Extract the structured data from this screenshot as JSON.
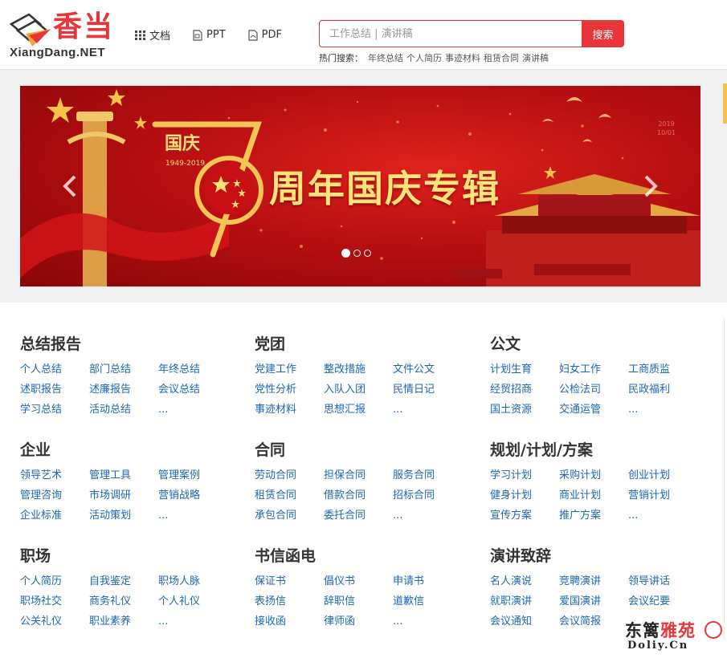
{
  "header": {
    "logo": {
      "cn": "香当",
      "en": "XiangDang.NET"
    },
    "nav": [
      {
        "label": "文档",
        "icon": "grid-icon"
      },
      {
        "label": "PPT",
        "icon": "ppt-file-icon"
      },
      {
        "label": "PDF",
        "icon": "pdf-file-icon"
      }
    ],
    "search": {
      "placeholder": "工作总结 | 演讲稿",
      "button": "搜索"
    },
    "hot": {
      "label": "热门搜索：",
      "terms": [
        "年终总结",
        "个人简历",
        "事迹材料",
        "租赁合同",
        "演讲稿"
      ]
    }
  },
  "banner": {
    "title": "周年国庆专辑",
    "guoqing": "国庆",
    "years": "1949-2019",
    "date_line1": "2019",
    "date_line2": "10/01",
    "slides": 3,
    "active_slide": 0
  },
  "categories": [
    {
      "title": "总结报告",
      "links": [
        "个人总结",
        "部门总结",
        "年终总结",
        "述职报告",
        "述廉报告",
        "会议总结",
        "学习总结",
        "活动总结",
        "..."
      ]
    },
    {
      "title": "党团",
      "links": [
        "党建工作",
        "整改措施",
        "文件公文",
        "党性分析",
        "入队入团",
        "民情日记",
        "事迹材料",
        "思想汇报",
        "..."
      ]
    },
    {
      "title": "公文",
      "links": [
        "计划生育",
        "妇女工作",
        "工商质监",
        "经贸招商",
        "公检法司",
        "民政福利",
        "国土资源",
        "交通运管",
        "..."
      ]
    },
    {
      "title": "企业",
      "links": [
        "领导艺术",
        "管理工具",
        "管理案例",
        "管理咨询",
        "市场调研",
        "营销战略",
        "企业标准",
        "活动策划",
        "..."
      ]
    },
    {
      "title": "合同",
      "links": [
        "劳动合同",
        "担保合同",
        "服务合同",
        "租赁合同",
        "借款合同",
        "招标合同",
        "承包合同",
        "委托合同",
        "..."
      ]
    },
    {
      "title": "规划/计划/方案",
      "links": [
        "学习计划",
        "采购计划",
        "创业计划",
        "健身计划",
        "商业计划",
        "营销计划",
        "宣传方案",
        "推广方案",
        "..."
      ]
    },
    {
      "title": "职场",
      "links": [
        "个人简历",
        "自我鉴定",
        "职场人脉",
        "职场社交",
        "商务礼仪",
        "个人礼仪",
        "公关礼仪",
        "职业素养",
        "..."
      ]
    },
    {
      "title": "书信函电",
      "links": [
        "保证书",
        "倡仪书",
        "申请书",
        "表扬信",
        "辞职信",
        "道歉信",
        "接收函",
        "律师函",
        "..."
      ]
    },
    {
      "title": "演讲致辞",
      "links": [
        "名人演说",
        "竞聘演讲",
        "领导讲话",
        "就职演讲",
        "爱国演讲",
        "会议纪要",
        "会议通知",
        "会议简报"
      ]
    }
  ],
  "watermark": {
    "main_a": "东篱",
    "main_b": "雅苑",
    "sub": "Doliy.Cn"
  },
  "colors": {
    "brand_red": "#e8353a",
    "link_blue": "#1a66b5"
  }
}
